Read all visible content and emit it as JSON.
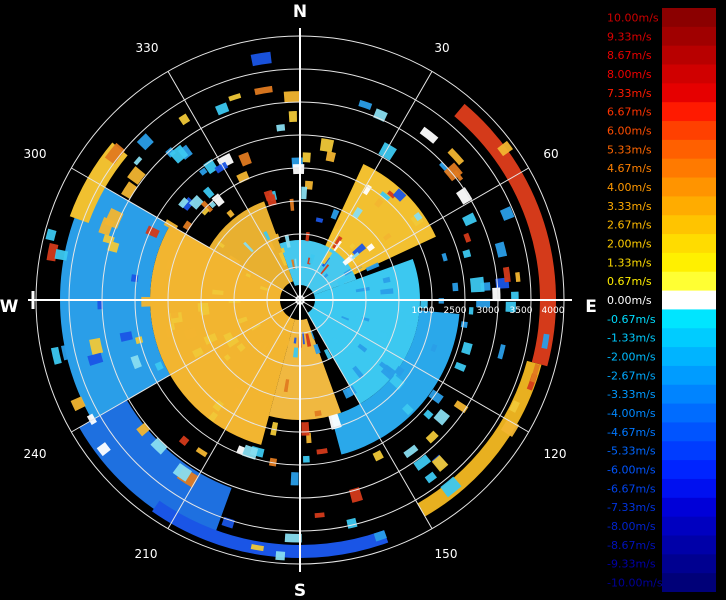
{
  "compass": {
    "north": "N",
    "south": "S",
    "east": "E",
    "west": "W"
  },
  "azimuth_labels": [
    "30",
    "60",
    "120",
    "150",
    "210",
    "240",
    "300",
    "330"
  ],
  "range_labels": [
    "1000",
    "2500",
    "3000",
    "3500",
    "4000"
  ],
  "legend": {
    "items": [
      {
        "label": "10.00m/s",
        "color": "#8b0000",
        "text_color": "#cc0000"
      },
      {
        "label": "9.33m/s",
        "color": "#a00000",
        "text_color": "#dd0000"
      },
      {
        "label": "8.67m/s",
        "color": "#b80000",
        "text_color": "#e60000"
      },
      {
        "label": "8.00m/s",
        "color": "#d00000",
        "text_color": "#ee0000"
      },
      {
        "label": "7.33m/s",
        "color": "#e60000",
        "text_color": "#ff1a00"
      },
      {
        "label": "6.67m/s",
        "color": "#ff1a00",
        "text_color": "#ff3300"
      },
      {
        "label": "6.00m/s",
        "color": "#ff4000",
        "text_color": "#ff4d00"
      },
      {
        "label": "5.33m/s",
        "color": "#ff6000",
        "text_color": "#ff6600"
      },
      {
        "label": "4.67m/s",
        "color": "#ff7a00",
        "text_color": "#ff8000"
      },
      {
        "label": "4.00m/s",
        "color": "#ff9400",
        "text_color": "#ff9900"
      },
      {
        "label": "3.33m/s",
        "color": "#ffac00",
        "text_color": "#ffaa00"
      },
      {
        "label": "2.67m/s",
        "color": "#ffc400",
        "text_color": "#ffbb00"
      },
      {
        "label": "2.00m/s",
        "color": "#ffdc00",
        "text_color": "#ffcc00"
      },
      {
        "label": "1.33m/s",
        "color": "#fff000",
        "text_color": "#ffdd00"
      },
      {
        "label": "0.67m/s",
        "color": "#ffff33",
        "text_color": "#ffee00"
      },
      {
        "label": "0.00m/s",
        "color": "#ffffff",
        "text_color": "#ffffff"
      },
      {
        "label": "-0.67m/s",
        "color": "#00e5ff",
        "text_color": "#00ddff"
      },
      {
        "label": "-1.33m/s",
        "color": "#00ccff",
        "text_color": "#00ccff"
      },
      {
        "label": "-2.00m/s",
        "color": "#00b4ff",
        "text_color": "#00bbff"
      },
      {
        "label": "-2.67m/s",
        "color": "#009cff",
        "text_color": "#00aaff"
      },
      {
        "label": "-3.33m/s",
        "color": "#0084ff",
        "text_color": "#0099ff"
      },
      {
        "label": "-4.00m/s",
        "color": "#006cff",
        "text_color": "#0088ff"
      },
      {
        "label": "-4.67m/s",
        "color": "#0054ff",
        "text_color": "#0077ff"
      },
      {
        "label": "-5.33m/s",
        "color": "#003cff",
        "text_color": "#0066ff"
      },
      {
        "label": "-6.00m/s",
        "color": "#0024ff",
        "text_color": "#0055ff"
      },
      {
        "label": "-6.67m/s",
        "color": "#0010f0",
        "text_color": "#0044ee"
      },
      {
        "label": "-7.33m/s",
        "color": "#0000d8",
        "text_color": "#0033dd"
      },
      {
        "label": "-8.00m/s",
        "color": "#0000c0",
        "text_color": "#0022cc"
      },
      {
        "label": "-8.67m/s",
        "color": "#0000a8",
        "text_color": "#0011bb"
      },
      {
        "label": "-9.33m/s",
        "color": "#000090",
        "text_color": "#0000aa"
      },
      {
        "label": "-10.00m/s",
        "color": "#000078",
        "text_color": "#000099"
      }
    ]
  },
  "colors": {
    "background": "#000000",
    "grid": "#e6e6e6",
    "warm_core": "#f2b530",
    "cool_core": "#3cc8f0",
    "blue_ring": "#1a55e6",
    "red_ring": "#d43a1a"
  }
}
